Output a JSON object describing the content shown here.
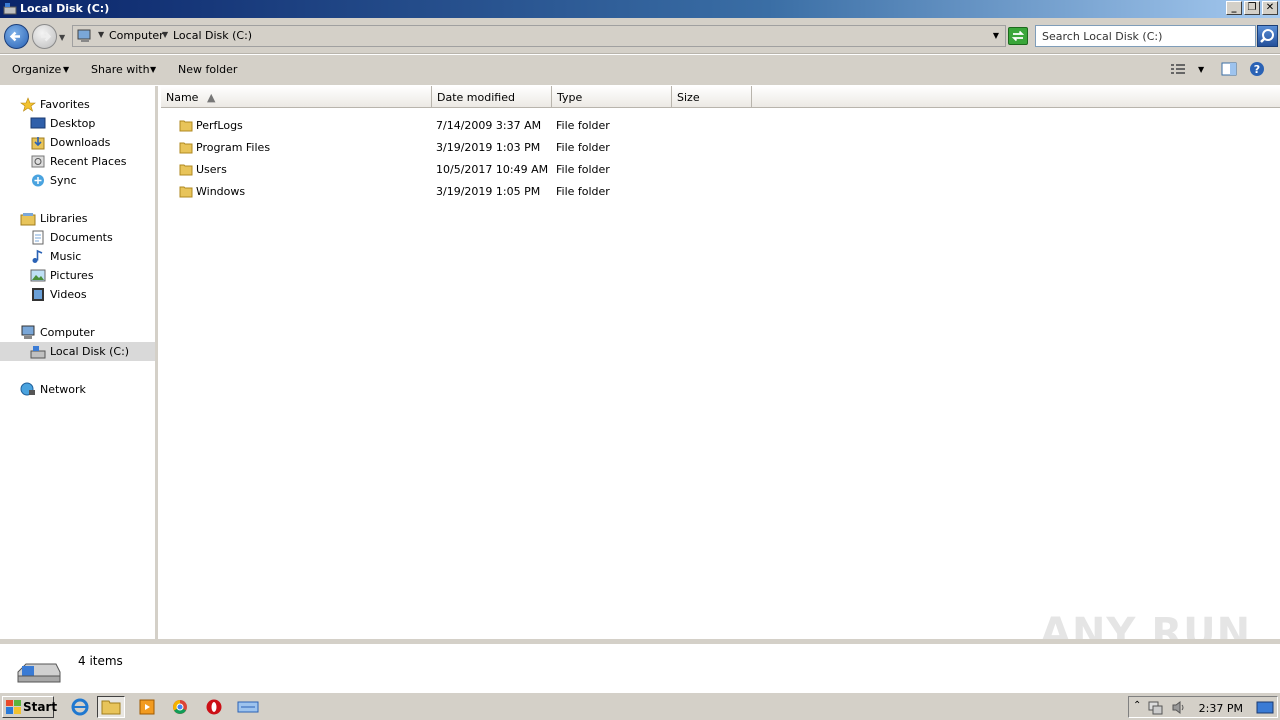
{
  "window": {
    "title": "Local Disk (C:)"
  },
  "window_buttons": [
    "_",
    "❐",
    "✕"
  ],
  "address": {
    "crumbs": [
      "Computer",
      "Local Disk (C:)"
    ],
    "search_placeholder": "Search Local Disk (C:)"
  },
  "toolbar": {
    "organize": "Organize",
    "share_with": "Share with",
    "new_folder": "New folder"
  },
  "nav": {
    "favorites": "Favorites",
    "desktop": "Desktop",
    "downloads": "Downloads",
    "recent": "Recent Places",
    "sync": "Sync",
    "libraries": "Libraries",
    "documents": "Documents",
    "music": "Music",
    "pictures": "Pictures",
    "videos": "Videos",
    "computer": "Computer",
    "local_disk": "Local Disk (C:)",
    "network": "Network"
  },
  "columns": {
    "name": "Name",
    "date": "Date modified",
    "type": "Type",
    "size": "Size"
  },
  "files": [
    {
      "name": "PerfLogs",
      "date": "7/14/2009 3:37 AM",
      "type": "File folder"
    },
    {
      "name": "Program Files",
      "date": "3/19/2019 1:03 PM",
      "type": "File folder"
    },
    {
      "name": "Users",
      "date": "10/5/2017 10:49 AM",
      "type": "File folder"
    },
    {
      "name": "Windows",
      "date": "3/19/2019 1:05 PM",
      "type": "File folder"
    }
  ],
  "status": {
    "count": "4 items"
  },
  "watermark": "ANY RUN",
  "taskbar": {
    "start": "Start",
    "clock": "2:37 PM"
  }
}
